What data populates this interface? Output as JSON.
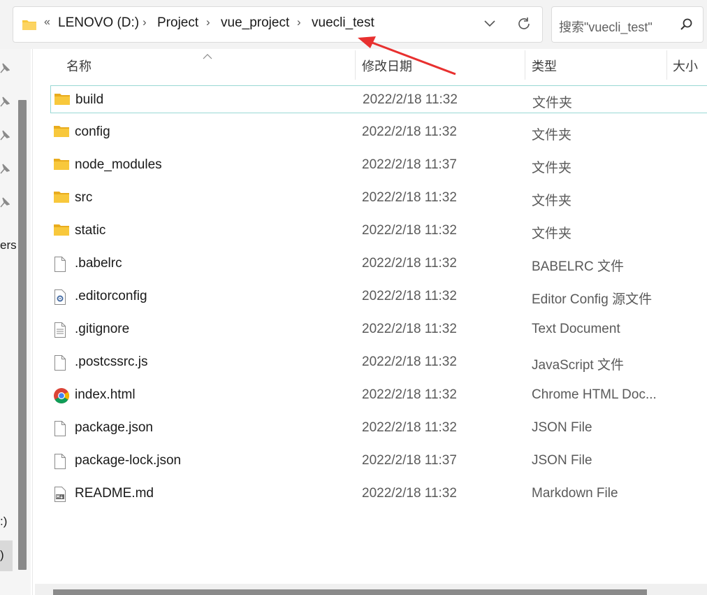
{
  "address_bar": {
    "overflow": "«",
    "breadcrumbs": [
      "LENOVO (D:)",
      "Project",
      "vue_project",
      "vuecli_test"
    ],
    "separator": "›"
  },
  "search": {
    "placeholder": "搜索\"vuecli_test\""
  },
  "nav_pane": {
    "fragments": [
      "ers",
      ":)",
      ")"
    ]
  },
  "columns": {
    "name": "名称",
    "date": "修改日期",
    "type": "类型",
    "size": "大小"
  },
  "files": [
    {
      "name": "build",
      "date": "2022/2/18 11:32",
      "type": "文件夹",
      "icon": "folder-icon"
    },
    {
      "name": "config",
      "date": "2022/2/18 11:32",
      "type": "文件夹",
      "icon": "folder-icon"
    },
    {
      "name": "node_modules",
      "date": "2022/2/18 11:37",
      "type": "文件夹",
      "icon": "folder-icon"
    },
    {
      "name": "src",
      "date": "2022/2/18 11:32",
      "type": "文件夹",
      "icon": "folder-icon"
    },
    {
      "name": "static",
      "date": "2022/2/18 11:32",
      "type": "文件夹",
      "icon": "folder-icon"
    },
    {
      "name": ".babelrc",
      "date": "2022/2/18 11:32",
      "type": "BABELRC 文件",
      "icon": "file-icon"
    },
    {
      "name": ".editorconfig",
      "date": "2022/2/18 11:32",
      "type": "Editor Config 源文件",
      "icon": "config-file-icon"
    },
    {
      "name": ".gitignore",
      "date": "2022/2/18 11:32",
      "type": "Text Document",
      "icon": "text-file-icon"
    },
    {
      "name": ".postcssrc.js",
      "date": "2022/2/18 11:32",
      "type": "JavaScript 文件",
      "icon": "file-icon"
    },
    {
      "name": "index.html",
      "date": "2022/2/18 11:32",
      "type": "Chrome HTML Doc...",
      "icon": "chrome-icon"
    },
    {
      "name": "package.json",
      "date": "2022/2/18 11:32",
      "type": "JSON File",
      "icon": "file-icon"
    },
    {
      "name": "package-lock.json",
      "date": "2022/2/18 11:37",
      "type": "JSON File",
      "icon": "file-icon"
    },
    {
      "name": "README.md",
      "date": "2022/2/18 11:32",
      "type": "Markdown File",
      "icon": "markdown-file-icon"
    }
  ],
  "colors": {
    "selection_border": "#99d8d4",
    "folder": "#f8c83c",
    "annotation_arrow": "#e8302f"
  }
}
